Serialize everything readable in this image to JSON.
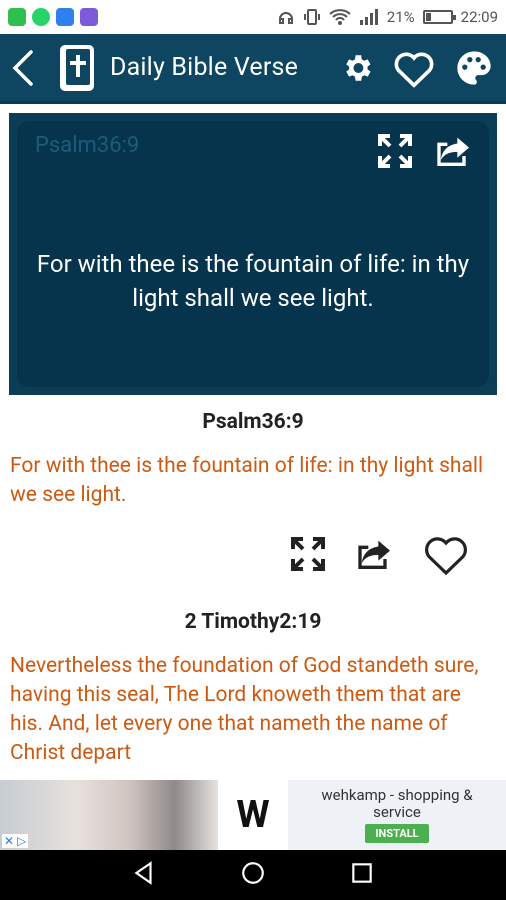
{
  "status_bar": {
    "signal_text": "21%",
    "time": "22:09",
    "battery_level": 0.21
  },
  "app_bar": {
    "title": "Daily Bible Verse",
    "icons": [
      "back-arrow",
      "bible-logo",
      "settings-gear",
      "favorite-heart",
      "palette"
    ]
  },
  "featured": {
    "reference": "Psalm36:9",
    "text": "For with thee is the fountain of life: in thy light shall we see light."
  },
  "verses": [
    {
      "reference": "Psalm36:9",
      "text": "For with thee is the fountain of life: in thy light shall we see light."
    },
    {
      "reference": "2 Timothy2:19",
      "text": "Nevertheless the foundation of God standeth sure, having this seal, The Lord knoweth them that are his. And, let every one that nameth the name of Christ depart"
    }
  ],
  "ad": {
    "brand_letter": "W",
    "title": "wehkamp - shopping & service",
    "cta": "INSTALL"
  },
  "colors": {
    "app_bar": "#0e4662",
    "card": "#06344d",
    "verse_text": "#cc5a12",
    "install": "#4caf50"
  }
}
